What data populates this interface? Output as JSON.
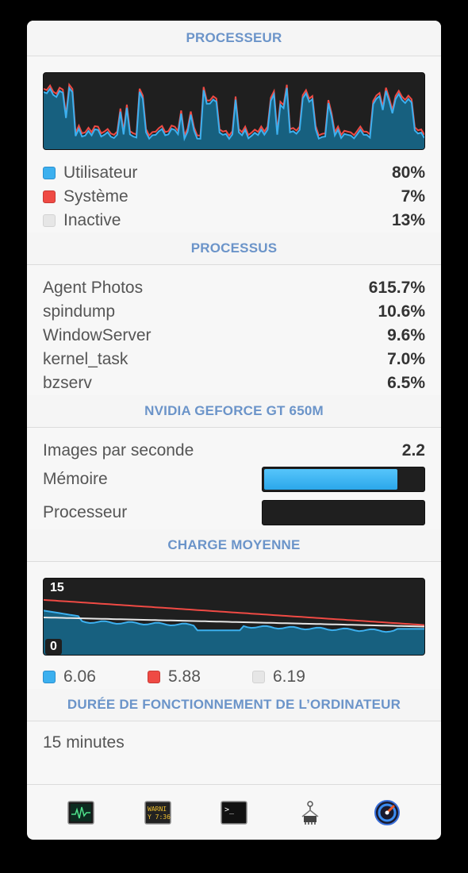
{
  "cpu": {
    "header": "PROCESSEUR",
    "legend": [
      {
        "label": "Utilisateur",
        "value": "80%",
        "color": "#3cb0ef"
      },
      {
        "label": "Système",
        "value": "7%",
        "color": "#ef4a44"
      },
      {
        "label": "Inactive",
        "value": "13%",
        "color": "#e6e6e6"
      }
    ]
  },
  "processes": {
    "header": "PROCESSUS",
    "items": [
      {
        "name": "Agent Photos",
        "value": "615.7%"
      },
      {
        "name": "spindump",
        "value": "10.6%"
      },
      {
        "name": "WindowServer",
        "value": "9.6%"
      },
      {
        "name": "kernel_task",
        "value": "7.0%"
      },
      {
        "name": "bzserv",
        "value": "6.5%"
      }
    ]
  },
  "gpu": {
    "header": "NVIDIA GEFORCE GT 650M",
    "fps_label": "Images par seconde",
    "fps_value": "2.2",
    "memory_label": "Mémoire",
    "memory_fraction": 0.83,
    "processor_label": "Processeur",
    "processor_fraction": 0.0
  },
  "load": {
    "header": "CHARGE MOYENNE",
    "scale_max": "15",
    "scale_min": "0",
    "legend": [
      {
        "value": "6.06",
        "color": "#3cb0ef"
      },
      {
        "value": "5.88",
        "color": "#ef4a44"
      },
      {
        "value": "6.19",
        "color": "#e6e6e6"
      }
    ]
  },
  "uptime": {
    "header": "DURÉE DE FONCTIONNEMENT DE L’ORDINATEUR",
    "value": "15 minutes"
  },
  "toolbar": {
    "icons": [
      "activity-monitor-icon",
      "console-icon",
      "terminal-icon",
      "system-information-icon",
      "disk-utility-icon"
    ]
  }
}
